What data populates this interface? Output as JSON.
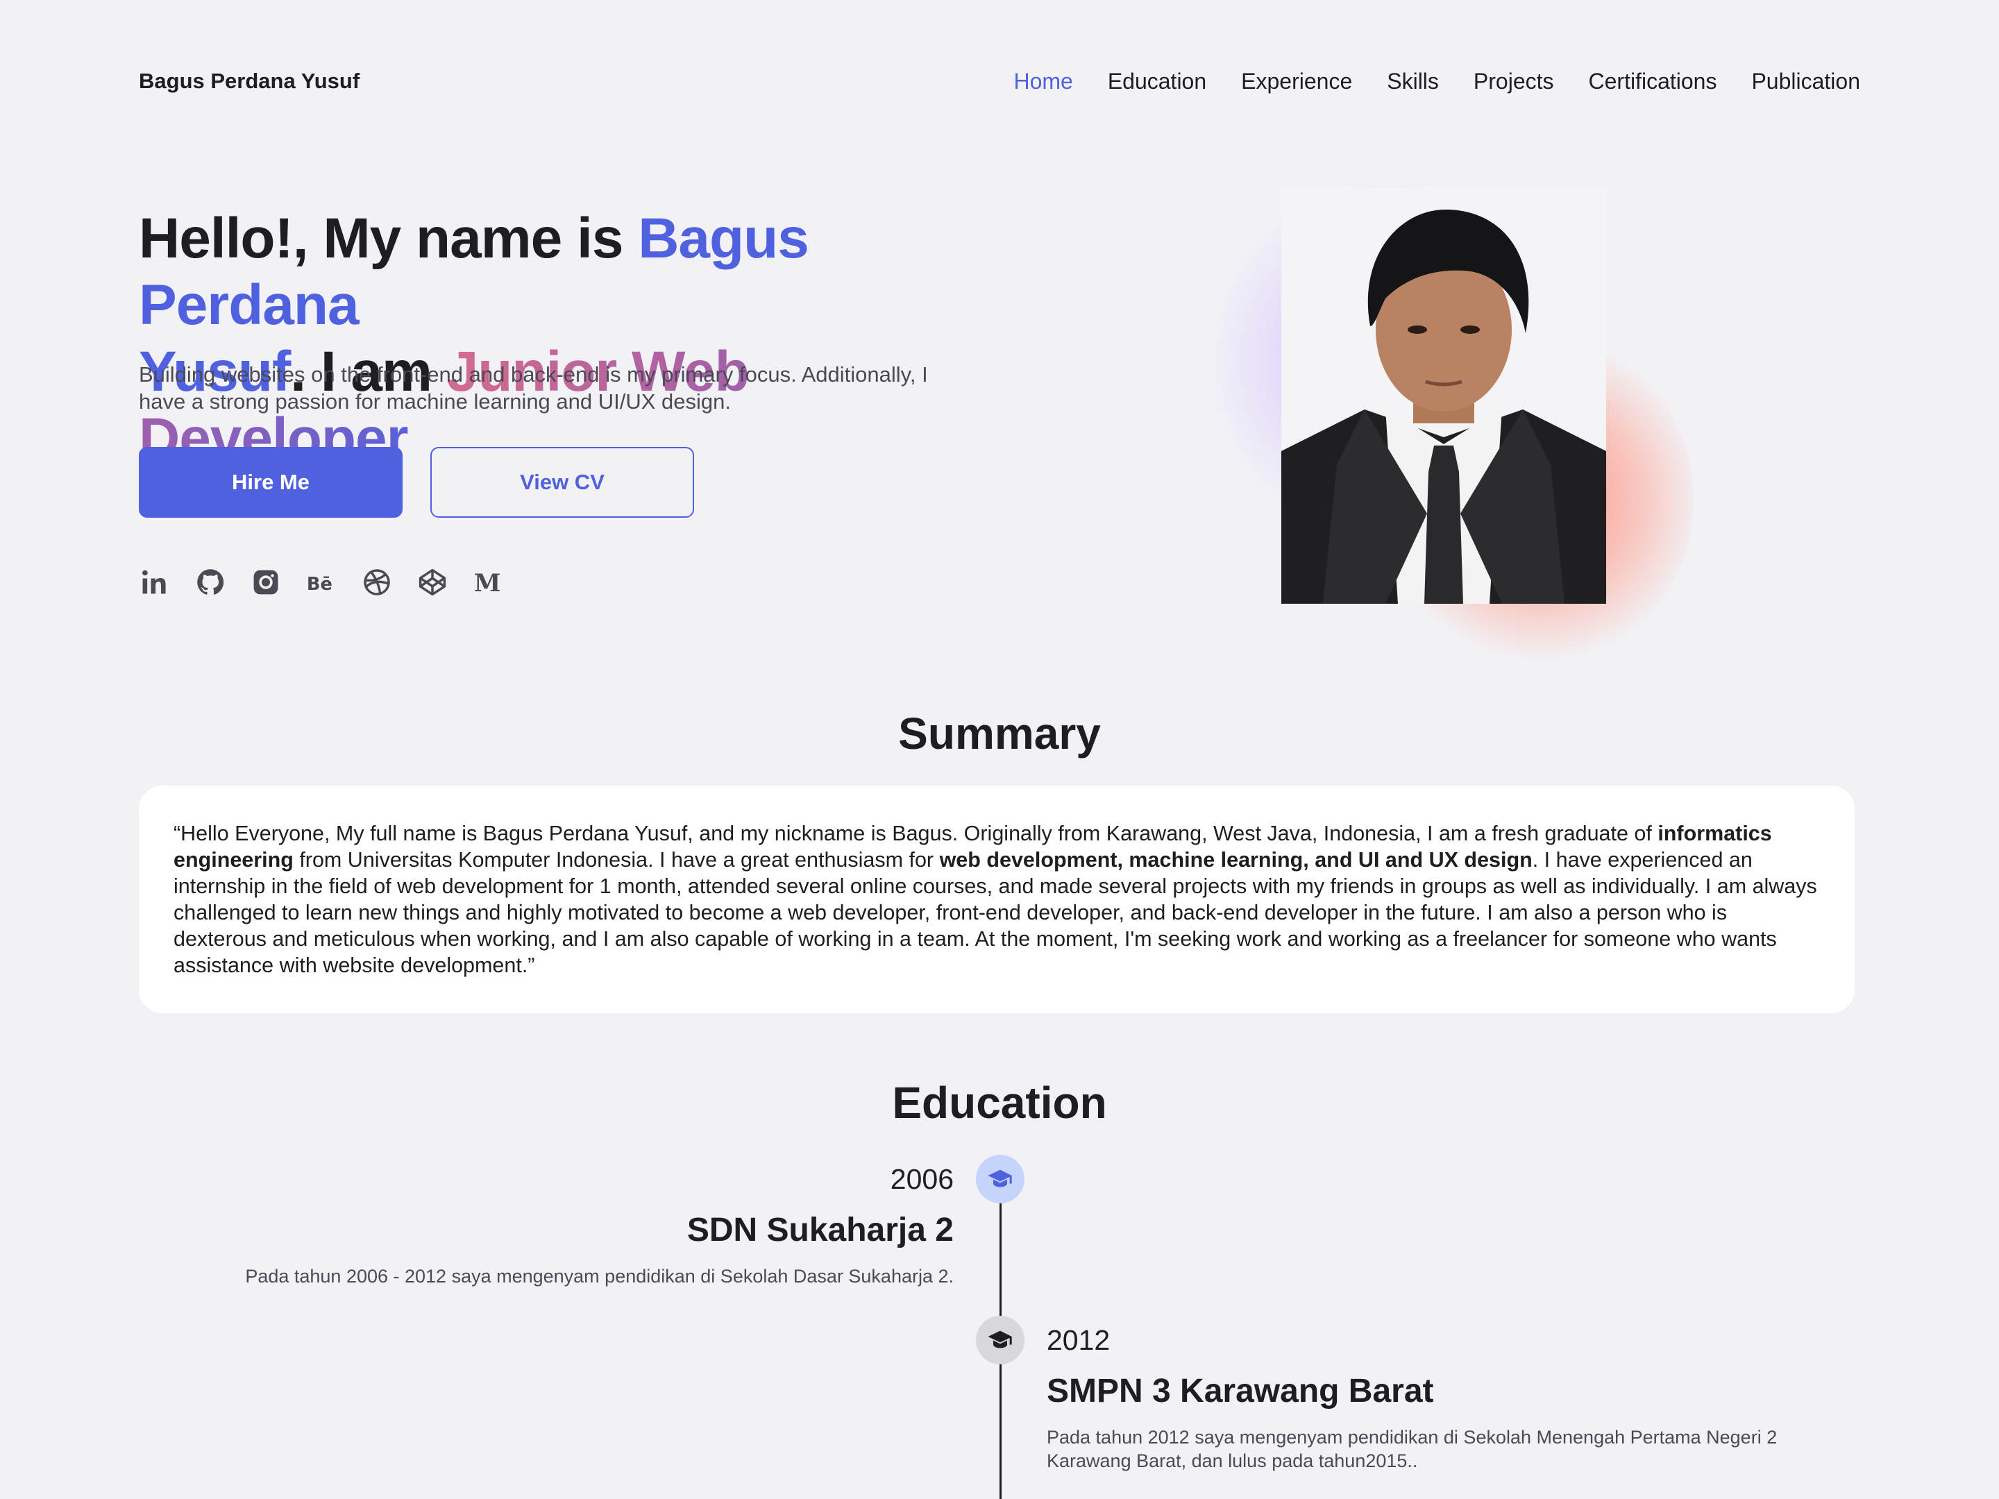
{
  "nav": {
    "brand": "Bagus Perdana Yusuf",
    "links": [
      "Home",
      "Education",
      "Experience",
      "Skills",
      "Projects",
      "Certifications",
      "Publication"
    ],
    "active": "Home"
  },
  "hero": {
    "title_prefix": "Hello!, My name is ",
    "title_name_line1": "Bagus Perdana",
    "title_name_line2": "Yusuf",
    "title_middle": ". I am ",
    "title_role": "Junior Web Developer",
    "subtitle": "Building websites on the front-end and back-end is my primary focus. Additionally, I have a strong passion for machine learning and UI/UX design.",
    "hire_label": "Hire Me",
    "cv_label": "View CV"
  },
  "socials": [
    "linkedin-icon",
    "github-icon",
    "instagram-icon",
    "behance-icon",
    "dribbble-icon",
    "codepen-icon",
    "medium-icon"
  ],
  "summary": {
    "title": "Summary",
    "part1": "“Hello Everyone, My full name is Bagus Perdana Yusuf, and my nickname is Bagus. Originally from Karawang, West Java, Indonesia, I am a fresh graduate of ",
    "bold1": "informatics engineering",
    "part2": " from Universitas Komputer Indonesia. I have a great enthusiasm for ",
    "bold2": "web development, machine learning, and UI and UX design",
    "part3": ". I have experienced an internship in the field of web development for 1 month, attended several online courses, and made several projects with my friends in groups as well as individually. I am always challenged to learn new things and highly motivated to become a web developer, front-end developer, and back-end developer in the future. I am also a person who is dexterous and meticulous when working, and I am also capable of working in a team. At the moment, I'm seeking work and working as a freelancer for someone who wants assistance with website development.”"
  },
  "education": {
    "title": "Education",
    "items": [
      {
        "year": "2006",
        "school": "SDN Sukaharja 2",
        "desc": "Pada tahun 2006 - 2012 saya mengenyam pendidikan di Sekolah Dasar Sukaharja 2."
      },
      {
        "year": "2012",
        "school": "SMPN 3 Karawang Barat",
        "desc": "Pada tahun 2012 saya mengenyam pendidikan di Sekolah Menengah Pertama Negeri 2 Karawang Barat, dan lulus  pada tahun2015.."
      }
    ]
  },
  "colors": {
    "accent": "#5061e0",
    "background": "#f2f2f6",
    "text": "#1d1d22"
  }
}
